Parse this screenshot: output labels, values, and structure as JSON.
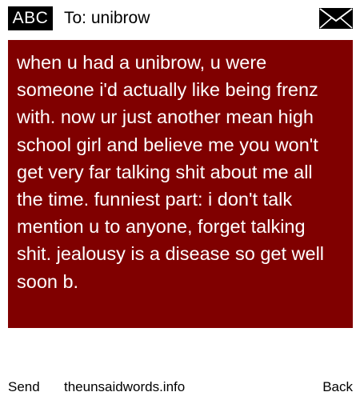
{
  "header": {
    "badge": "ABC",
    "recipient": "To: unibrow",
    "envelope_icon": "envelope-icon"
  },
  "message": {
    "text": "when u had a unibrow, u were someone i'd actually like being frenz with. now ur just another mean high school girl and believe me you won't get very far talking shit about me all the time. funniest part: i don't talk mention u to anyone, forget talking shit. jealousy is a disease so get well soon b.",
    "background_color": "#800000",
    "text_color": "#ffffff"
  },
  "footer": {
    "send_label": "Send",
    "site": "theunsaidwords.info",
    "back_label": "Back"
  }
}
